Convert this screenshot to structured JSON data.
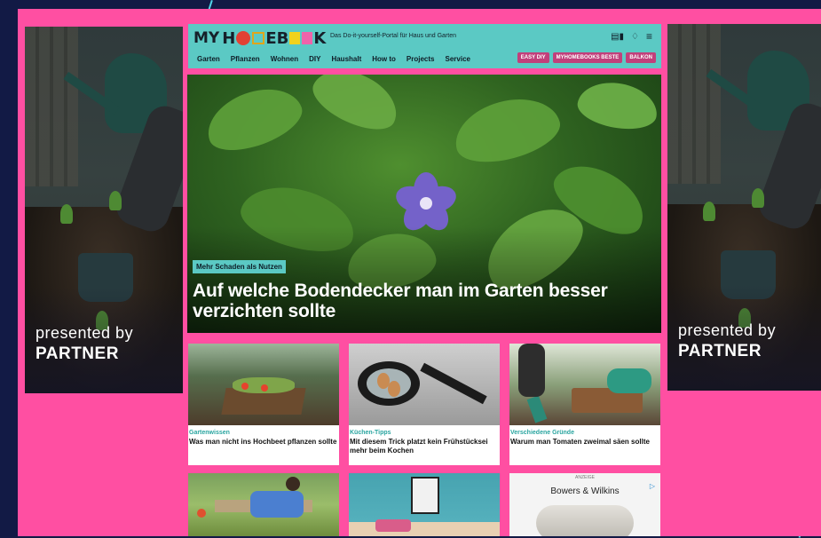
{
  "side_ads": {
    "presented_by": "presented by",
    "partner": "PARTNER"
  },
  "header": {
    "logo_text_my": "MY",
    "logo_text_k": "K",
    "tagline": "Das Do-it-yourself-Portal für Haus und Garten",
    "nav_items": [
      "Garten",
      "Pflanzen",
      "Wohnen",
      "DIY",
      "Haushalt",
      "How to",
      "Projects",
      "Service"
    ],
    "pills": [
      "EASY DIY",
      "MYHOMEBOOKS BESTE",
      "BALKON"
    ]
  },
  "hero": {
    "kicker": "Mehr Schaden als Nutzen",
    "title": "Auf welche Bodendecker man im Garten besser verzichten sollte"
  },
  "cards": [
    {
      "category": "Gartenwissen",
      "title": "Was man nicht ins Hochbeet pflanzen sollte"
    },
    {
      "category": "Küchen-Tipps",
      "title": "Mit diesem Trick platzt kein Frühstücksei mehr beim Kochen"
    },
    {
      "category": "Verschiedene Gründe",
      "title": "Warum man Tomaten zweimal säen sollte"
    }
  ],
  "ad": {
    "label": "ANZEIGE",
    "brand": "Bowers & Wilkins",
    "info": "▷"
  },
  "colors": {
    "page_pink": "#ff4fa2",
    "header_teal": "#5bc9c4",
    "pill_magenta": "#c13f7b",
    "category_teal": "#2aa5a0",
    "outer_navy": "#121a45"
  }
}
